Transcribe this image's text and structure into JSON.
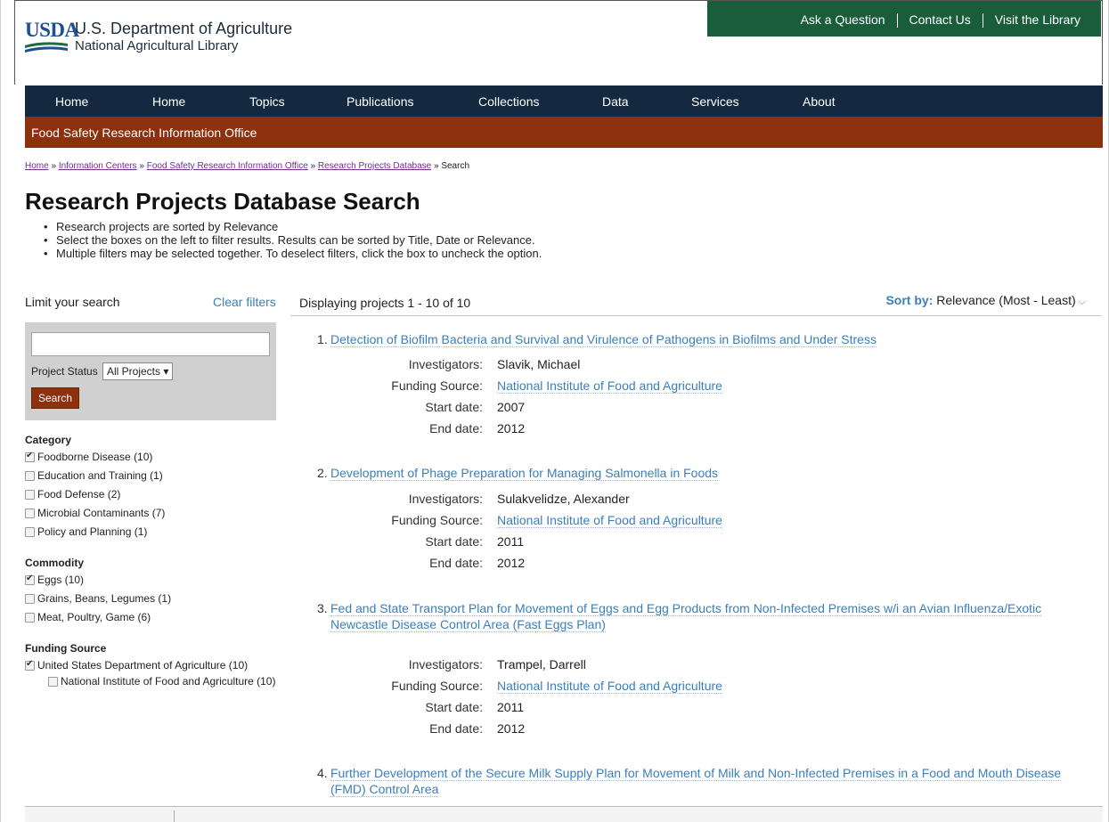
{
  "header": {
    "usda": "USDA",
    "dept": "U.S. Department of Agriculture",
    "library": "National Agricultural Library",
    "utility_links": [
      "Ask a Question",
      "Contact Us",
      "Visit the Library"
    ],
    "utility_color": "#1a5d3b"
  },
  "nav": {
    "items": [
      "Home",
      "Home",
      "Topics",
      "Publications",
      "Collections",
      "Data",
      "Services",
      "About"
    ],
    "bg_color": "#14283f"
  },
  "subbar": {
    "label": "Food Safety Research Information Office",
    "color": "#8c300e"
  },
  "breadcrumb": {
    "links": [
      "Home",
      "Information Centers",
      "Food Safety Research Information Office",
      "Research Projects Database"
    ],
    "current": "Search",
    "sep": "»"
  },
  "page": {
    "title": "Research Projects Database Search",
    "bullets": [
      "Research projects are sorted by Relevance",
      "Select the boxes on the left to filter results. Results can be sorted by Title, Date or Relevance.",
      "Multiple filters may be selected together. To deselect filters, click the box to uncheck the option."
    ]
  },
  "sidebar": {
    "limit_label": "Limit your search",
    "clear_filters": "Clear filters",
    "search_value": "",
    "status_label": "Project Status",
    "status_value": "All Projects ▾",
    "search_button": "Search",
    "facets": [
      {
        "title": "Category",
        "items": [
          {
            "label": "Foodborne Disease (10)",
            "checked": true
          },
          {
            "label": "Education and Training (1)",
            "checked": false
          },
          {
            "label": "Food Defense (2)",
            "checked": false
          },
          {
            "label": "Microbial Contaminants (7)",
            "checked": false
          },
          {
            "label": "Policy and Planning (1)",
            "checked": false
          }
        ]
      },
      {
        "title": "Commodity",
        "items": [
          {
            "label": "Eggs (10)",
            "checked": true
          },
          {
            "label": "Grains, Beans, Legumes (1)",
            "checked": false
          },
          {
            "label": "Meat, Poultry, Game (6)",
            "checked": false
          }
        ]
      },
      {
        "title": "Funding Source",
        "items": [
          {
            "label": "United States Department of Agriculture (10)",
            "checked": true
          },
          {
            "label": "National Institute of Food and Agriculture (10)",
            "checked": false,
            "indent": true
          }
        ]
      }
    ]
  },
  "results": {
    "heading": "Displaying projects 1 - 10 of 10",
    "sort_label": "Sort by:",
    "sort_value": "Relevance (Most - Least)",
    "labels": {
      "investigators": "Investigators:",
      "funding": "Funding Source:",
      "start": "Start date:",
      "end": "End date:"
    },
    "projects": [
      {
        "num": "1.",
        "title": "Detection of Biofilm Bacteria and Survival and Virulence of Pathogens in Biofilms and Under Stress",
        "investigators": "Slavik, Michael",
        "funding": "National Institute of Food and Agriculture",
        "start": "2007",
        "end": "2012"
      },
      {
        "num": "2.",
        "title": "Development of Phage Preparation for Managing Salmonella in Foods",
        "investigators": "Sulakvelidze, Alexander",
        "funding": "National Institute of Food and Agriculture",
        "start": "2011",
        "end": "2012"
      },
      {
        "num": "3.",
        "title": "Fed and State Transport Plan for Movement of Eggs and Egg Products from Non-Infected Premises w/i an Avian Influenza/Exotic Newcastle Disease Control Area (Fast Eggs Plan)",
        "investigators": "Trampel, Darrell",
        "funding": "National Institute of Food and Agriculture",
        "start": "2011",
        "end": "2012"
      },
      {
        "num": "4.",
        "title": "Further Development of the Secure Milk Supply Plan for Movement of Milk and Non-Infected Premises in a Food and Mouth Disease (FMD) Control Area"
      }
    ]
  }
}
